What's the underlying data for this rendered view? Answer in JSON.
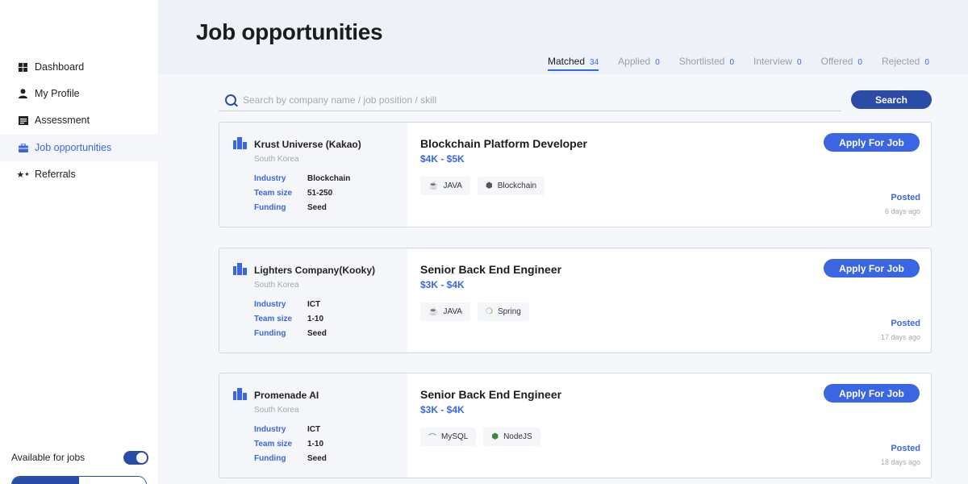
{
  "sidebar": {
    "items": [
      {
        "label": "Dashboard",
        "icon": "dashboard-icon"
      },
      {
        "label": "My Profile",
        "icon": "person-icon"
      },
      {
        "label": "Assessment",
        "icon": "assessment-icon"
      },
      {
        "label": "Job opportunities",
        "icon": "briefcase-icon",
        "active": true
      },
      {
        "label": "Referrals",
        "icon": "stars-icon"
      }
    ],
    "available_label": "Available for jobs",
    "available_on": true
  },
  "main": {
    "title": "Job opportunities",
    "tabs": [
      {
        "label": "Matched",
        "count": "34"
      },
      {
        "label": "Applied",
        "count": "0"
      },
      {
        "label": "Shortlisted",
        "count": "0"
      },
      {
        "label": "Interview",
        "count": "0"
      },
      {
        "label": "Offered",
        "count": "0"
      },
      {
        "label": "Rejected",
        "count": "0"
      }
    ],
    "search": {
      "placeholder": "Search by company name / job position / skill",
      "button_label": "Search"
    },
    "jobs": [
      {
        "company": "Krust Universe (Kakao)",
        "country": "South Korea",
        "industry_key": "Industry",
        "industry": "Blockchain",
        "team_key": "Team size",
        "team": "51-250",
        "funding_key": "Funding",
        "funding": "Seed",
        "title": "Blockchain Platform Developer",
        "salary": "$4K - $5K",
        "skills": [
          "JAVA",
          "Blockchain"
        ],
        "apply_label": "Apply For Job",
        "posted_label": "Posted",
        "posted_ago": "6 days ago"
      },
      {
        "company": "Lighters Company(Kooky)",
        "country": "South Korea",
        "industry_key": "Industry",
        "industry": "ICT",
        "team_key": "Team size",
        "team": "1-10",
        "funding_key": "Funding",
        "funding": "Seed",
        "title": "Senior Back End Engineer",
        "salary": "$3K - $4K",
        "skills": [
          "JAVA",
          "Spring"
        ],
        "apply_label": "Apply For Job",
        "posted_label": "Posted",
        "posted_ago": "17 days ago"
      },
      {
        "company": "Promenade AI",
        "country": "South Korea",
        "industry_key": "Industry",
        "industry": "ICT",
        "team_key": "Team size",
        "team": "1-10",
        "funding_key": "Funding",
        "funding": "Seed",
        "title": "Senior Back End Engineer",
        "salary": "$3K - $4K",
        "skills": [
          "MySQL",
          "NodeJS"
        ],
        "apply_label": "Apply For Job",
        "posted_label": "Posted",
        "posted_ago": "18 days ago"
      }
    ]
  },
  "colors": {
    "accent": "#3b66e3",
    "primary_dark": "#2a4ba6",
    "muted_text": "#a3a8b0",
    "panel": "#f4f6fa"
  }
}
